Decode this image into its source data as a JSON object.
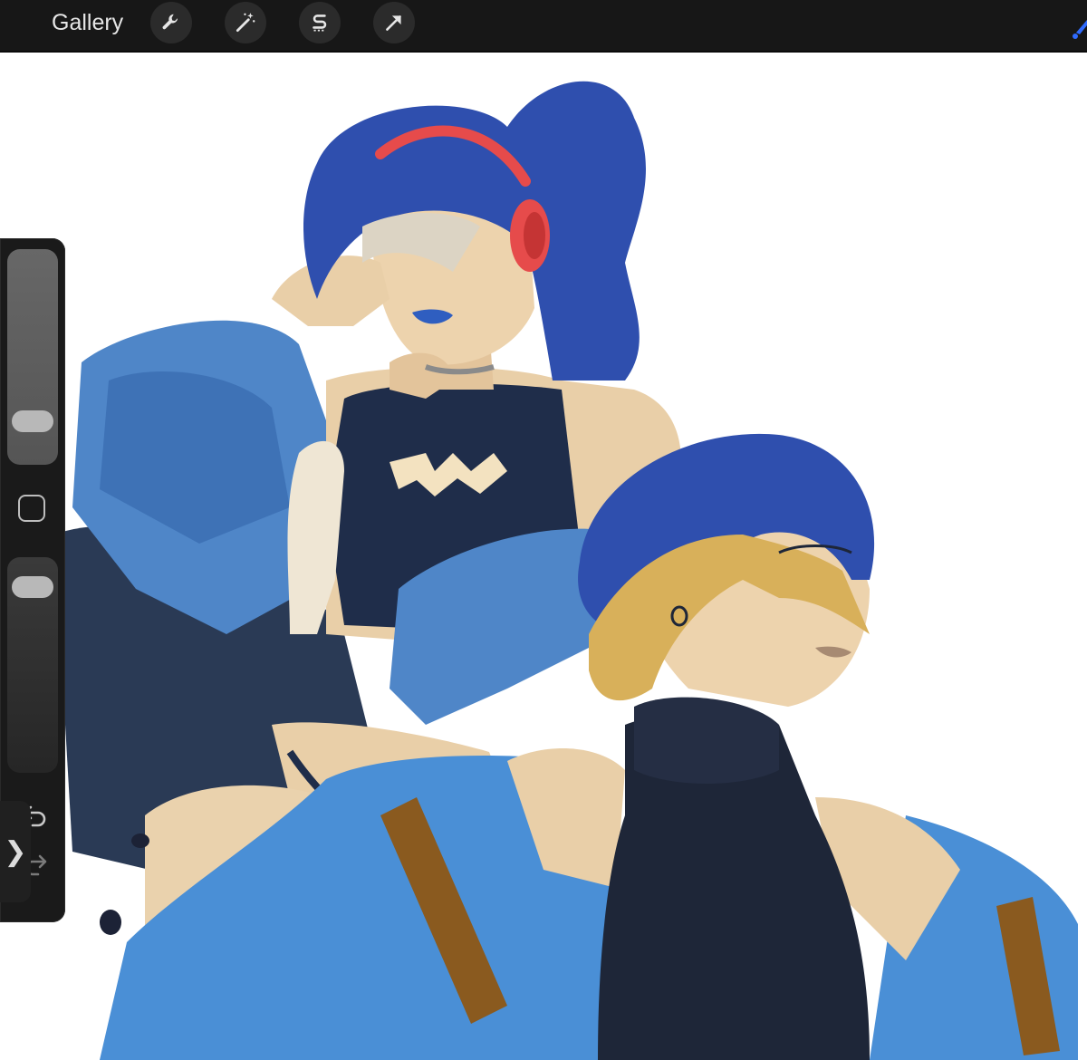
{
  "toolbar": {
    "gallery_label": "Gallery",
    "tools": [
      {
        "name": "actions",
        "icon": "wrench-icon"
      },
      {
        "name": "adjustments",
        "icon": "magic-wand-icon"
      },
      {
        "name": "selection",
        "icon": "selection-s-icon"
      },
      {
        "name": "transform",
        "icon": "arrow-icon"
      }
    ],
    "active_color": "#2f6bff"
  },
  "sidebar": {
    "brush_size_level": 0.15,
    "opacity_level": 0.92,
    "expand_glyph": "❯"
  },
  "colors": {
    "toolbar_bg": "#171717",
    "canvas_bg": "#ffffff",
    "jacket_blue": "#4f86c8",
    "hair_blue": "#2f4fae",
    "top_navy": "#1f2d4a",
    "skin": "#e9cfa8",
    "headphones_red": "#e64b4b",
    "hair_blonde": "#d8b05a"
  }
}
